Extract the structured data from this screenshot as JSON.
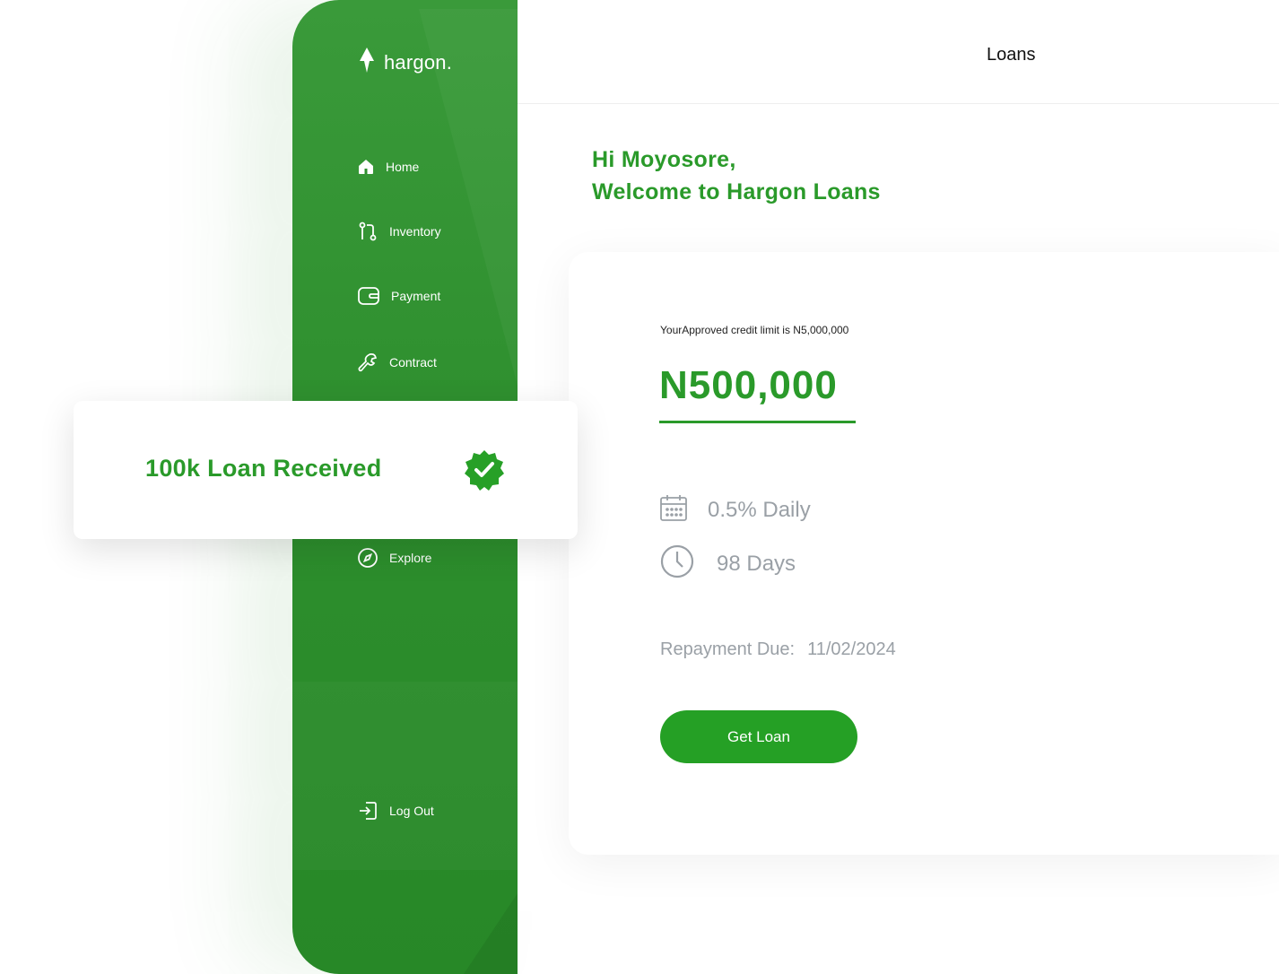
{
  "app": {
    "brand_name": "hargon."
  },
  "colors": {
    "primary": "#2e8f2e",
    "accent_text": "#2a9a2a",
    "button": "#25a025",
    "muted_text": "#9aa0a6"
  },
  "sidebar": {
    "items": [
      {
        "label": "Home",
        "icon": "home-icon"
      },
      {
        "label": "Inventory",
        "icon": "branch-icon"
      },
      {
        "label": "Payment",
        "icon": "wallet-icon"
      },
      {
        "label": "Contract",
        "icon": "wrench-icon"
      },
      {
        "label": "Explore",
        "icon": "compass-icon"
      }
    ],
    "logout_label": "Log Out"
  },
  "header": {
    "title": "Loans"
  },
  "greeting": {
    "line1": "Hi Moyosore,",
    "line2": "Welcome to Hargon Loans"
  },
  "loan": {
    "credit_limit_text": "YourApproved credit limit is N5,000,000",
    "amount": "N500,000",
    "rate": "0.5% Daily",
    "duration": "98 Days",
    "repayment_label": "Repayment Due:",
    "repayment_date": "11/02/2024",
    "cta_label": "Get Loan"
  },
  "notification": {
    "text": "100k Loan Received",
    "icon": "verified-badge-icon"
  }
}
